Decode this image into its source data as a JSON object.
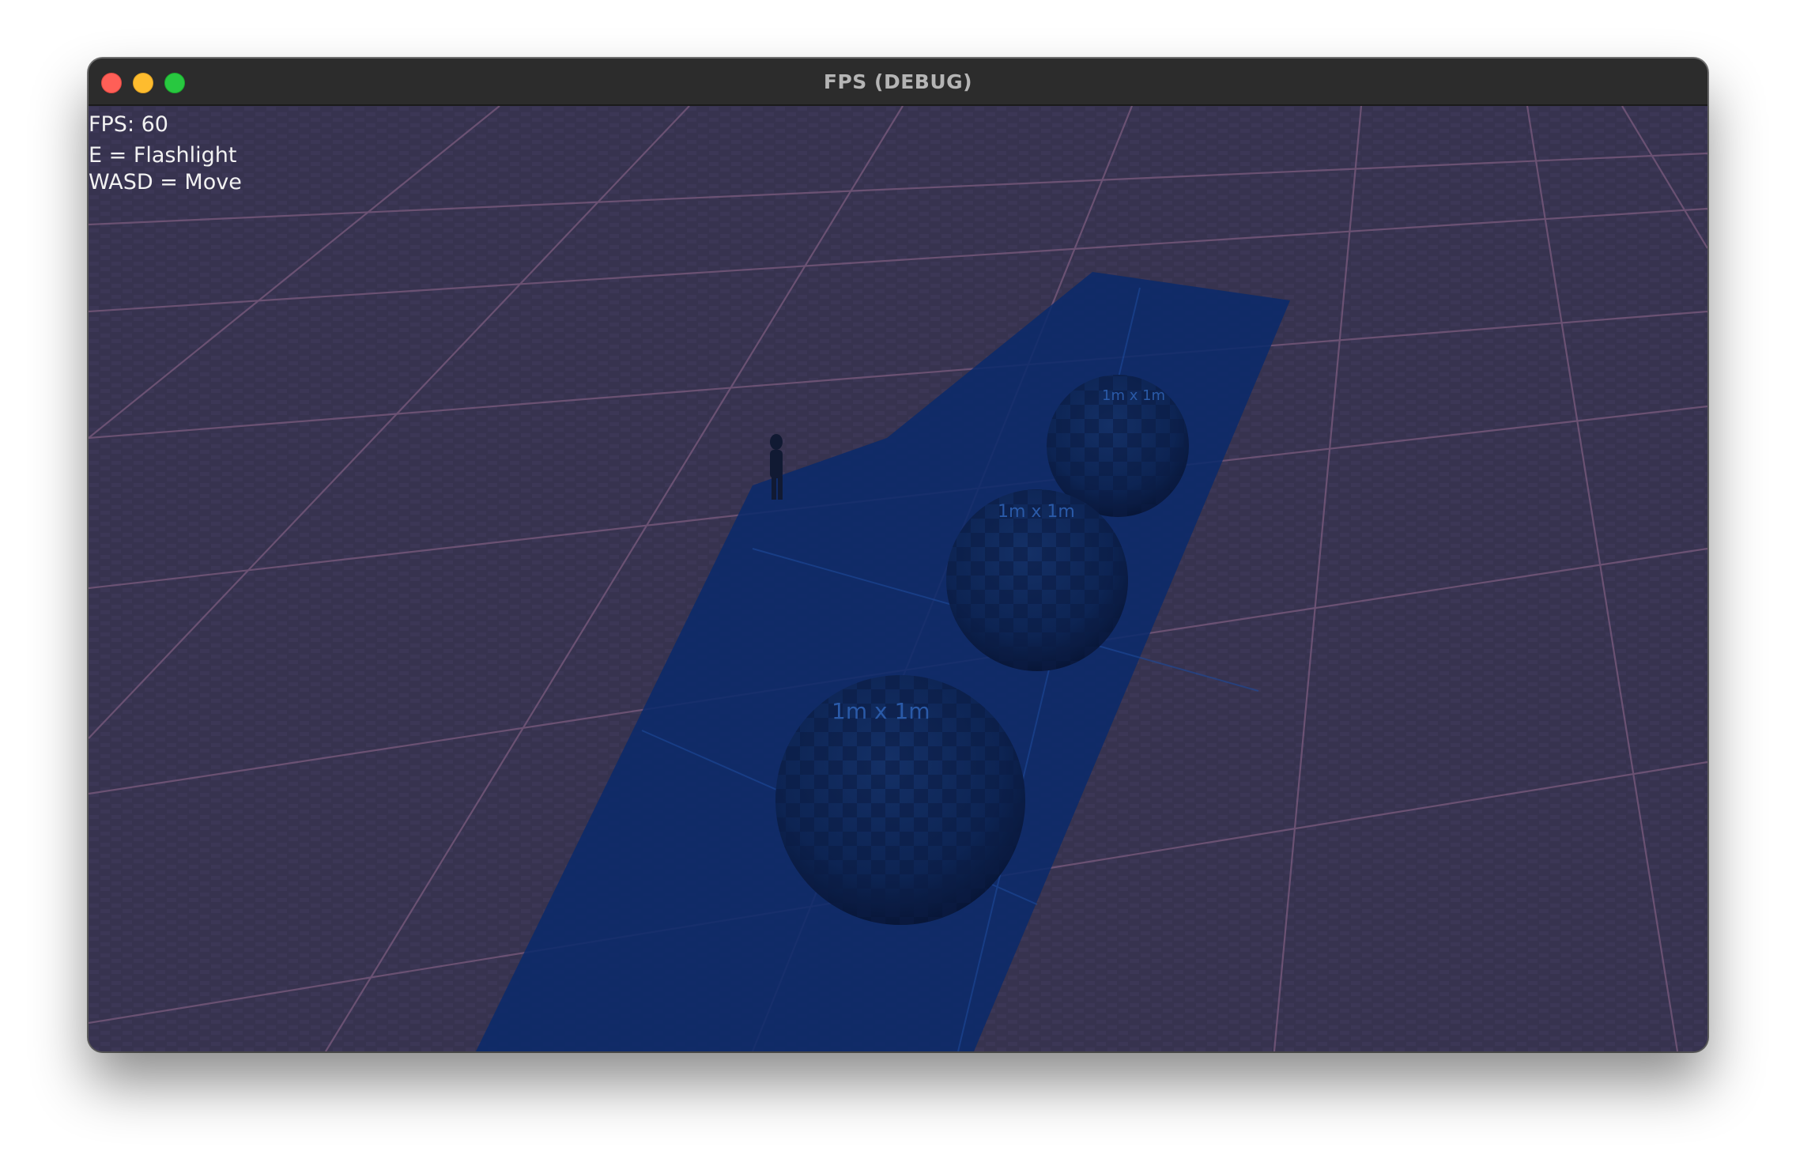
{
  "window": {
    "title": "FPS (DEBUG)",
    "buttons": {
      "close": "close",
      "minimize": "minimize",
      "maximize": "maximize"
    }
  },
  "hud": {
    "fps_text": "FPS: 60",
    "controls": [
      "E = Flashlight",
      "WASD = Move"
    ]
  },
  "scene": {
    "sphere_label": "1m x 1m",
    "colors": {
      "floor": "#36324f",
      "floor_grid": "#7a5a7a",
      "light_beam": "#0b2a6b",
      "sphere": "#0d2552",
      "traffic_close": "#ff5f57",
      "traffic_minimize": "#febc2e",
      "traffic_maximize": "#28c840"
    }
  }
}
